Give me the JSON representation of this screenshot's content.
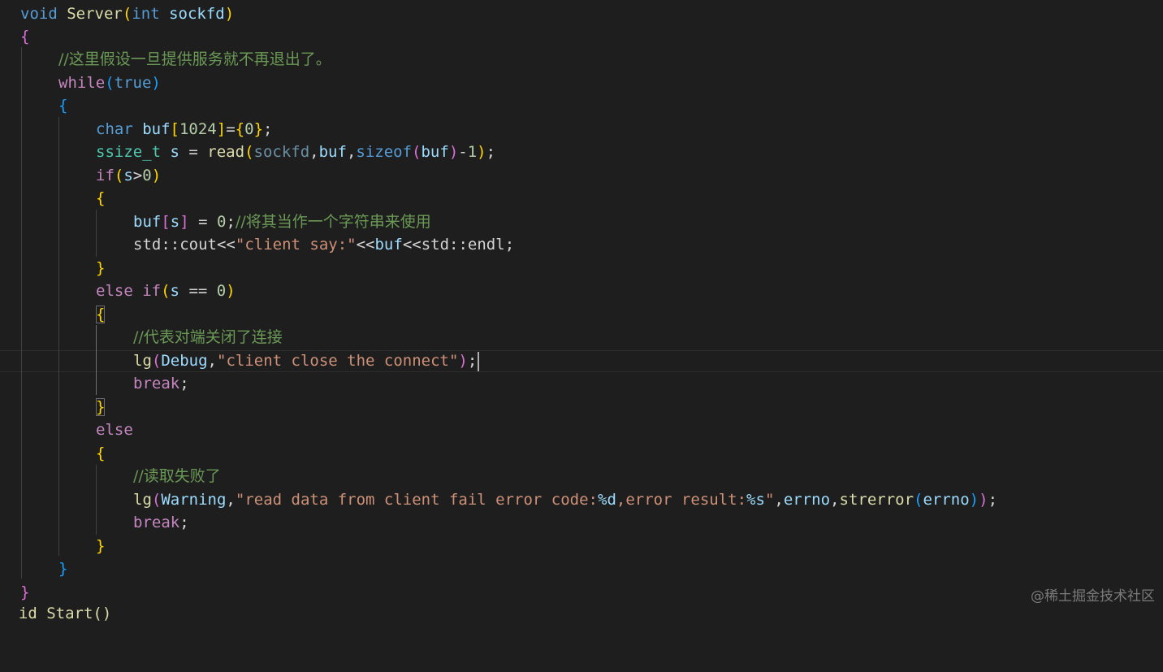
{
  "code": {
    "l1": {
      "void": "void",
      "name": "Server",
      "lp": "(",
      "int": "int",
      "param": " sockfd",
      "rp": ")"
    },
    "l2": {
      "lb": "{"
    },
    "l3": {
      "comment": "//这里假设一旦提供服务就不再退出了。"
    },
    "l4": {
      "while": "while",
      "lp": "(",
      "true": "true",
      "rp": ")"
    },
    "l5": {
      "lb": "{"
    },
    "l6": {
      "char": "char",
      "buf": " buf",
      "lb": "[",
      "num": "1024",
      "rb": "]",
      "eq": "=",
      "lc": "{",
      "zero": "0",
      "rc": "}",
      "semi": ";"
    },
    "l7": {
      "type": "ssize_t",
      "s": " s",
      "eq": " = ",
      "read": "read",
      "lp": "(",
      "sockfd": "sockfd",
      "comma1": ",",
      "buf": "buf",
      "comma2": ",",
      "sizeof": "sizeof",
      "lp2": "(",
      "buf2": "buf",
      "rp2": ")",
      "minus": "-",
      "one": "1",
      "rp": ")",
      "semi": ";"
    },
    "l8": {
      "if": "if",
      "lp": "(",
      "s": "s",
      "gt": ">",
      "zero": "0",
      "rp": ")"
    },
    "l9": {
      "lb": "{"
    },
    "l10": {
      "buf": "buf",
      "lb": "[",
      "s": "s",
      "rb": "]",
      "eq": " = ",
      "zero": "0",
      "semi": ";",
      "comment": "//将其当作一个字符串来使用"
    },
    "l11": {
      "std": "std",
      "sep1": "::",
      "cout": "cout",
      "op1": "<<",
      "str": "\"client say:\"",
      "op2": "<<",
      "buf": "buf",
      "op3": "<<",
      "std2": "std",
      "sep2": "::",
      "endl": "endl",
      "semi": ";"
    },
    "l12": {
      "rb": "}"
    },
    "l13": {
      "else": "else",
      "if": " if",
      "lp": "(",
      "s": "s",
      "eq": " == ",
      "zero": "0",
      "rp": ")"
    },
    "l14": {
      "lb": "{"
    },
    "l15": {
      "comment": "//代表对端关闭了连接"
    },
    "l16": {
      "lg": "lg",
      "lp": "(",
      "debug": "Debug",
      "comma": ",",
      "str": "\"client close the connect\"",
      "rp": ")",
      "semi": ";"
    },
    "l17": {
      "break": "break",
      "semi": ";"
    },
    "l18": {
      "rb": "}"
    },
    "l19": {
      "else": "else"
    },
    "l20": {
      "lb": "{"
    },
    "l21": {
      "comment": "//读取失败了"
    },
    "l22": {
      "lg": "lg",
      "lp": "(",
      "warning": "Warning",
      "comma1": ",",
      "str1": "\"read data from client fail error code:",
      "fmt1": "%d",
      "str2": ",error result:",
      "fmt2": "%s",
      "str3": "\"",
      "comma2": ",",
      "errno1": "errno",
      "comma3": ",",
      "strerror": "strerror",
      "lp2": "(",
      "errno2": "errno",
      "rp2": ")",
      "rp": ")",
      "semi": ";"
    },
    "l23": {
      "break": "break",
      "semi": ";"
    },
    "l24": {
      "rb": "}"
    },
    "l25": {
      "rb": "}"
    },
    "l26": {
      "rb": "}"
    },
    "l27": {
      "partial": "  id Start()"
    }
  },
  "watermark": "@稀土掘金技术社区",
  "colors": {
    "background": "#1e1e1e",
    "keyword": "#569cd6",
    "control": "#c586c0",
    "function": "#dcdcaa",
    "variable": "#9cdcfe",
    "type": "#4ec9b0",
    "string": "#ce9178",
    "number": "#b5cea8",
    "comment": "#6a9955",
    "bracket_gold": "#ffd700",
    "bracket_orchid": "#da70d6",
    "bracket_blue": "#179fff"
  }
}
